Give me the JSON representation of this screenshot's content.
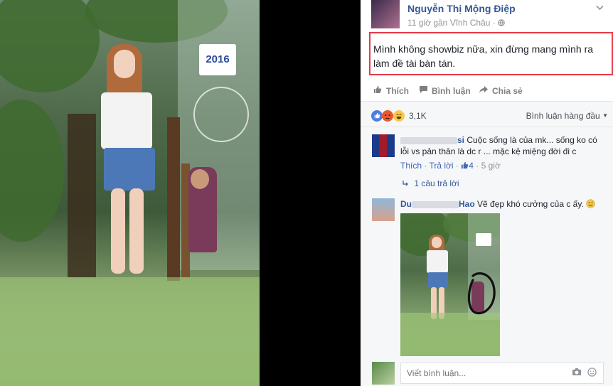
{
  "photo": {
    "sign_text": "2016"
  },
  "post": {
    "author": "Nguyễn Thị Mộng Điệp",
    "meta": "11 giờ gần Vĩnh Châu · ",
    "status": "Mình không showbiz nữa, xin đừng mang mình ra làm đề tài bàn tán.",
    "actions": {
      "like": "Thích",
      "comment": "Bình luận",
      "share": "Chia sẻ"
    }
  },
  "reactions": {
    "count": "3,1K",
    "sort_label": "Bình luận hàng đầu"
  },
  "comments": [
    {
      "name_visible": "si",
      "text": "Cuộc sống là của mk... sống ko có lỗi vs pản thân là dc r ... mặc kệ miệng đời đi c",
      "like_label": "Thích",
      "reply_label": "Trả lời",
      "likes": "4",
      "time": "5 giờ",
      "replies_label": "1 câu trả lời"
    },
    {
      "name_prefix": "Du",
      "name_suffix": "Hao",
      "text": "Vẽ đẹp khó cưởng của c ấy."
    }
  ],
  "composer": {
    "placeholder": "Viết bình luận..."
  },
  "colors": {
    "link": "#365899",
    "highlight_border": "#e53b46",
    "comments_bg": "#f6f7f9"
  },
  "icons": [
    "thumbs-up-icon",
    "speech-bubble-icon",
    "share-arrow-icon",
    "globe-icon",
    "chevron-down-icon",
    "camera-icon",
    "sticker-icon",
    "smiley-icon"
  ]
}
